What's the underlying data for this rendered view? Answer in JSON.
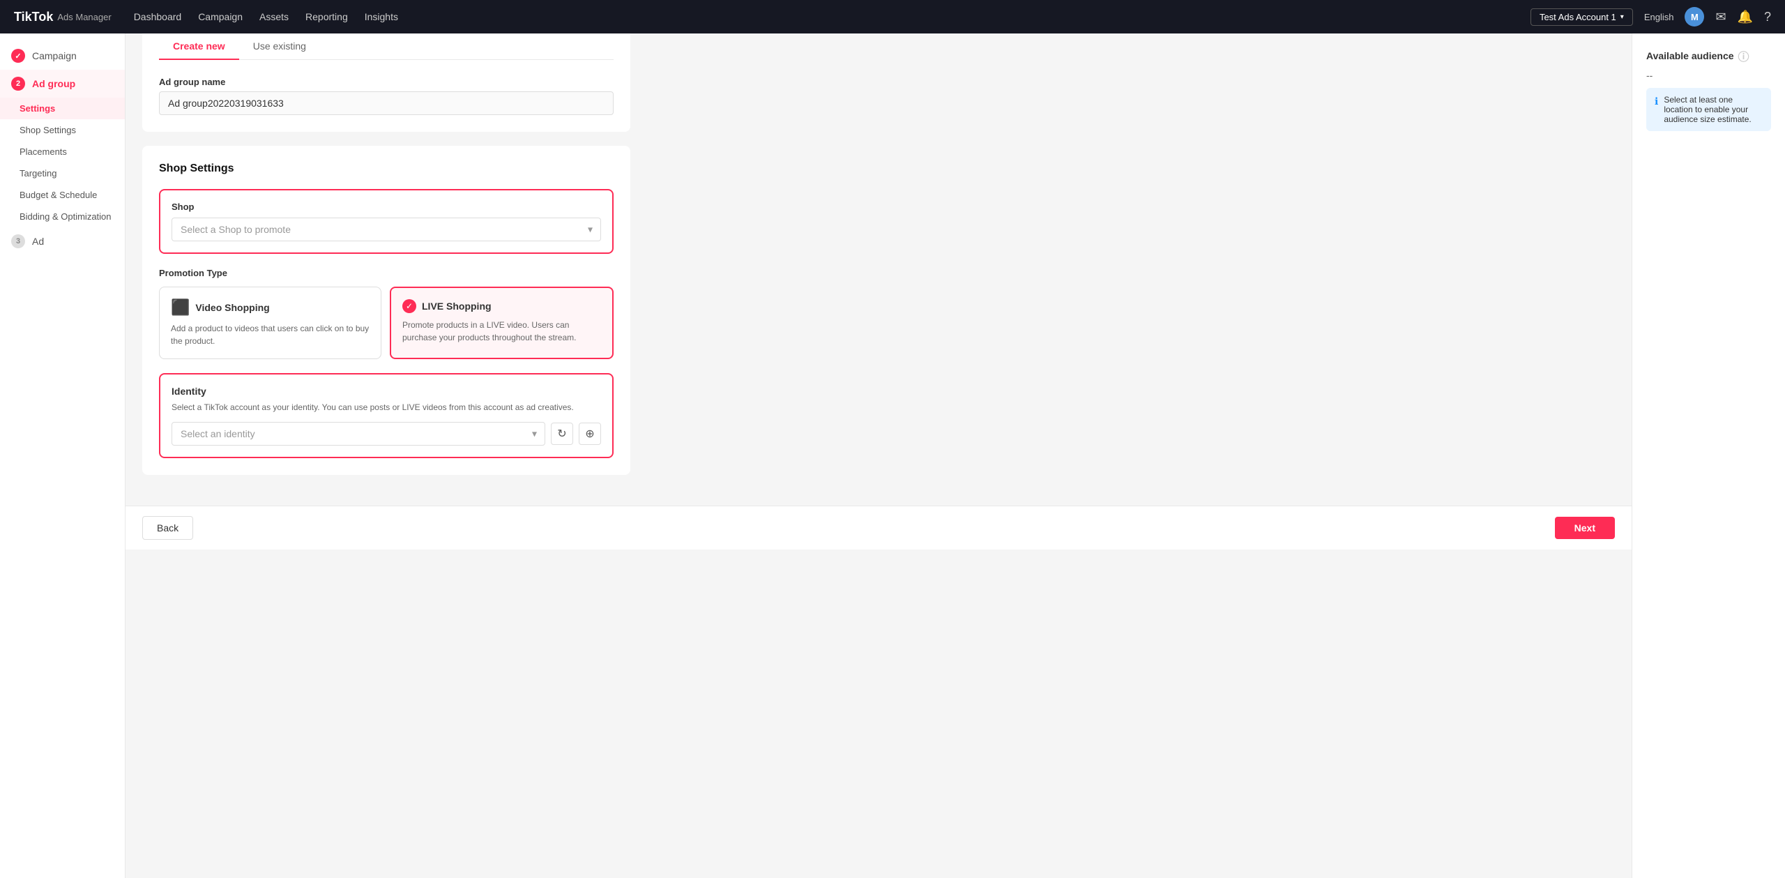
{
  "topnav": {
    "logo_tiktok": "TikTok",
    "logo_separator": "·",
    "logo_sub": "Ads Manager",
    "nav_links": [
      {
        "label": "Dashboard",
        "id": "dashboard"
      },
      {
        "label": "Campaign",
        "id": "campaign"
      },
      {
        "label": "Assets",
        "id": "assets"
      },
      {
        "label": "Reporting",
        "id": "reporting"
      },
      {
        "label": "Insights",
        "id": "insights"
      }
    ],
    "account_name": "Test Ads Account 1",
    "language": "English",
    "avatar_initial": "M"
  },
  "sidebar": {
    "items": [
      {
        "id": "campaign",
        "label": "Campaign",
        "step": "check",
        "type": "done"
      },
      {
        "id": "ad-group",
        "label": "Ad group",
        "step": "2",
        "type": "active"
      }
    ],
    "sub_items": [
      {
        "id": "settings",
        "label": "Settings",
        "active": true
      },
      {
        "id": "shop-settings",
        "label": "Shop Settings",
        "active": false
      },
      {
        "id": "placements",
        "label": "Placements",
        "active": false
      },
      {
        "id": "targeting",
        "label": "Targeting",
        "active": false
      },
      {
        "id": "budget-schedule",
        "label": "Budget & Schedule",
        "active": false
      },
      {
        "id": "bidding-optimization",
        "label": "Bidding & Optimization",
        "active": false
      }
    ],
    "ad_item": {
      "id": "ad",
      "label": "Ad",
      "step": "3",
      "type": "inactive"
    }
  },
  "tabs": [
    {
      "id": "create-new",
      "label": "Create new",
      "active": true
    },
    {
      "id": "use-existing",
      "label": "Use existing",
      "active": false
    }
  ],
  "ad_group_name": {
    "label": "Ad group name",
    "value": "Ad group20220319031633"
  },
  "shop_settings": {
    "section_title": "Shop Settings",
    "shop": {
      "label": "Shop",
      "placeholder": "Select a Shop to promote"
    },
    "promotion_type": {
      "label": "Promotion Type",
      "options": [
        {
          "id": "video-shopping",
          "title": "Video Shopping",
          "desc": "Add a product to videos that users can click on to buy the product.",
          "selected": false,
          "icon": "🎬"
        },
        {
          "id": "live-shopping",
          "title": "LIVE Shopping",
          "desc": "Promote products in a LIVE video. Users can purchase your products throughout the stream.",
          "selected": true,
          "icon": "📺"
        }
      ]
    },
    "identity": {
      "label": "Identity",
      "desc": "Select a TikTok account as your identity. You can use posts or LIVE videos from this account as ad creatives.",
      "placeholder": "Select an identity"
    }
  },
  "right_panel": {
    "title": "Available audience",
    "dash": "--",
    "info_text": "Select at least one location to enable your audience size estimate."
  },
  "bottom_bar": {
    "back_label": "Back",
    "next_label": "Next"
  }
}
